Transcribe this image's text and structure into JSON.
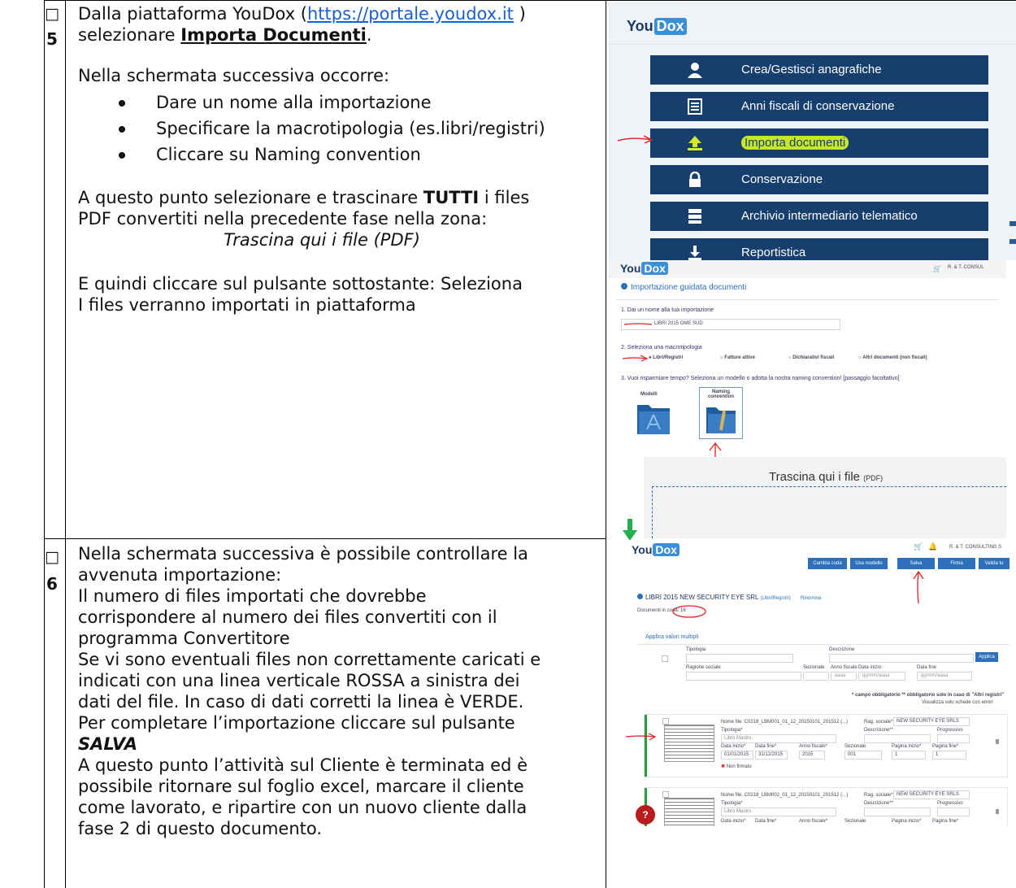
{
  "step5": {
    "checkbox": "□",
    "number": "5",
    "line1_pre": "Dalla piattaforma YouDox  (",
    "line1_link": "https://portale.youdox.it",
    "line1_post": " )",
    "line2_pre": "selezionare ",
    "line2_bold": "Importa Documenti",
    "line2_post": ".",
    "intro": "Nella schermata successiva occorre:",
    "bullets": [
      "Dare un nome alla importazione",
      "Specificare la macrotipologia (es.libri/registri)",
      "Cliccare su Naming convention"
    ],
    "p2_pre": "A questo punto selezionare e trascinare ",
    "p2_bold": "TUTTI",
    "p2_post": " i files",
    "p2_line2": "PDF convertiti nella precedente fase nella zona:",
    "p2_italic": "Trascina qui i file (PDF)",
    "p3_line1": "E quindi cliccare sul pulsante sottostante: Seleziona",
    "p3_line2": "I files verranno importati in piattaforma"
  },
  "step6": {
    "checkbox": "□",
    "number": "6",
    "lines": [
      "Nella schermata successiva è possibile controllare la",
      "avvenuta importazione:",
      "Il numero di files importati che dovrebbe",
      "corrispondere al numero dei files convertiti con il",
      "programma Convertitore",
      "Se vi sono eventuali files non correttamente caricati e",
      "indicati con una linea verticale ROSSA a sinistra dei",
      "dati del file. In caso di dati corretti la linea è VERDE.",
      "Per completare l’importazione cliccare sul pulsante"
    ],
    "salva": "SALVA",
    "lines_end": [
      "A questo punto l’attività sul Cliente è terminata ed è",
      "possibile ritornare sul foglio excel, marcare il cliente",
      "come lavorato, e ripartire con un nuovo cliente dalla",
      "fase 2 di questo documento."
    ]
  },
  "shot_menu": {
    "logo_you": "You",
    "logo_dox": "Dox",
    "items": [
      {
        "label": "Crea/Gestisci anagrafiche",
        "icon": "user-icon"
      },
      {
        "label": "Anni fiscali di conservazione",
        "icon": "list-icon"
      },
      {
        "label": "Importa documenti",
        "icon": "upload-icon"
      },
      {
        "label": "Conservazione",
        "icon": "lock-icon"
      },
      {
        "label": "Archivio intermediario telematico",
        "icon": "server-icon"
      },
      {
        "label": "Reportistica",
        "icon": "download-icon"
      }
    ]
  },
  "shot_import": {
    "logo_you": "You",
    "logo_dox": "Dox",
    "header_right": "R. & T. CONSUL",
    "title": "Importazione guidata documenti",
    "q1": "1. Dai un nome alla tua importazione",
    "q1_value": "LIBRI 2015 OME SUD",
    "q2": "2. Seleziona una macrotipologia",
    "options": [
      "Libri/Registri",
      "Fatture attive",
      "Dichiarativi fiscali",
      "Altri documenti (non fiscali)"
    ],
    "q3": "3. Vuoi risparmiare tempo? Seleziona un modello o adotta la nostra naming convention! [passaggio facoltativo]",
    "modelli": "Modelli",
    "naming": "Naming convention",
    "drop_main": "Trascina qui i file",
    "drop_small": "(PDF)"
  },
  "shot_review": {
    "logo_you": "You",
    "logo_dox": "Dox",
    "header_right": "R. & T. CONSULTING S",
    "buttons": [
      "Cambia coda",
      "Usa modello",
      "Salva",
      "Firma",
      "Valida tu"
    ],
    "company": "LIBRI 2015 NEW SECURITY EYE SRL",
    "company_type": "(Libri/Registri)",
    "rinomina": "Rinomina",
    "docs_label": "Documenti in coda: 16",
    "multi": "Applica valori multipli",
    "tipologia": "Tipologia",
    "descrizione": "Descrizione",
    "applica": "Applica",
    "ragione": "Ragione sociale",
    "sezionale": "Sezionale",
    "anno": "Anno fiscale",
    "data_inizio": "Data inizio",
    "data_fine": "Data fine",
    "anno_ph": "aaaa",
    "date_ph": "gg/mm/aaaa",
    "note": "* campo obbligatorio   ** obbligatorio solo in caso di \"Altri registri\"",
    "show_err": "Visualizza solo schede con errori",
    "rows": [
      {
        "file": "Nome file: C0218_LBM001_01_12_20150101_201512 (...)",
        "rag": "NEW SECURITY EYE SRLS",
        "tip": "Libro Mastro",
        "d1": "01/01/2015",
        "d2": "31/12/2015",
        "anno": "2015",
        "sez": "001",
        "p1": "1",
        "p2": "1",
        "status": "Non firmato"
      },
      {
        "file": "Nome file: C0218_LBM002_01_12_20150101_201512 (...)",
        "rag": "NEW SECURITY EYE SRLS",
        "tip": "Libro Mastro",
        "d1": "",
        "d2": "",
        "anno": "",
        "sez": "",
        "p1": "",
        "p2": "",
        "status": ""
      }
    ],
    "lbl_rag": "Rag. sociale*",
    "lbl_tip": "Tipologia*",
    "lbl_desc": "Descrizione**",
    "lbl_prog": "Progressivo",
    "lbl_di": "Data inizio*",
    "lbl_df": "Data fine*",
    "lbl_af": "Anno fiscale*",
    "lbl_sez": "Sezionale",
    "lbl_pi": "Pagina inizio*",
    "lbl_pf": "Pagina fine*",
    "help": "?"
  }
}
